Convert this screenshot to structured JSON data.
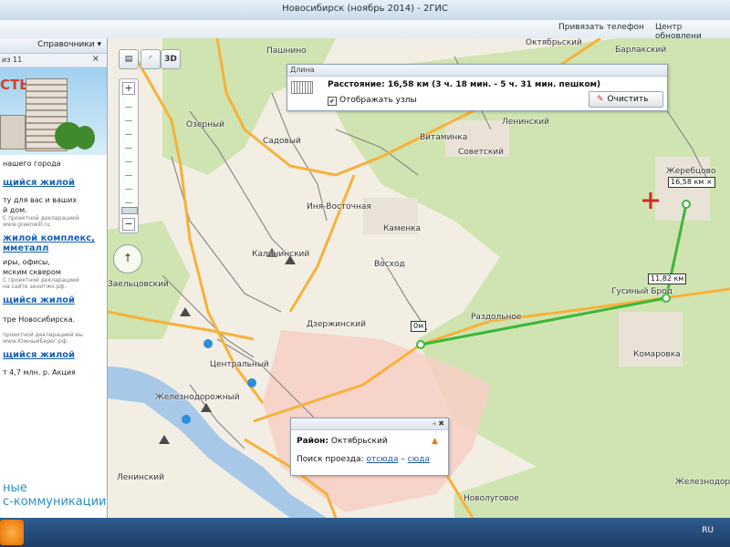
{
  "window": {
    "title": "Новосибирск (ноябрь 2014) - 2ГИС"
  },
  "toolbar": {
    "bind_phone": "Привязать телефон",
    "update_center": "Центр обновлени"
  },
  "sidebar": {
    "header": "Справочники ▾",
    "counter": "из 11",
    "close": "×",
    "ad_bigword": "СТЬ",
    "ad_caption": "нашего города",
    "blocks": [
      {
        "link": "щийся жилой",
        "text": "ту для вас и ваших\nй дом.",
        "note": "С проектной декларацией\nwww.greenwill.ru."
      },
      {
        "link": "жилой комплекс,\nмметалл",
        "text": "иры, офисы,\nмским сквером",
        "note": "С проектной декларацией\nна сайте зенитжк.рф."
      },
      {
        "link": "щийся жилой",
        "text": "тре Новосибирска.",
        "note": "проектной декларацией вы\nwww.ЮжныйБерег.рф."
      },
      {
        "link": "щийся жилой",
        "text": "т 4,7 млн. р. Акция\n",
        "note": ""
      }
    ],
    "bottom_line1": "ные",
    "bottom_line2": "с-коммуникации"
  },
  "map": {
    "controls": {
      "layers_icon": "layers-icon",
      "view3d": "3D",
      "zoom_in": "+",
      "zoom_out": "−",
      "compass": "↑"
    },
    "labels": [
      "Пашнино",
      "Октябрьский",
      "Барлакский",
      "Озерный",
      "Садовый",
      "Ленинский",
      "Витаминка",
      "Советский",
      "Жеребцово",
      "Иня-Восточная",
      "Каменка",
      "Калининский",
      "Восход",
      "Заельцовский",
      "Гусиный Брод",
      "Раздольное",
      "Дзержинский",
      "Комаровка",
      "Центральный",
      "Железнодорожный",
      "Ленинский",
      "Новолуговое",
      "Железнодор"
    ],
    "route_markers": [
      {
        "label": "0м"
      },
      {
        "label": "11,82 км"
      },
      {
        "label": "16,58 км ×"
      }
    ]
  },
  "distance_panel": {
    "title": "Длина",
    "distance_text": "Расстояние: 16,58 км (3 ч. 18 мин. - 5 ч. 31 мин. пешком)",
    "show_nodes": "Отображать узлы",
    "checked_mark": "✔",
    "clear_button": "Очистить"
  },
  "info_panel": {
    "district_label": "Район:",
    "district_value": "Октябрьский",
    "search_label": "Поиск проезда:",
    "from_link": "отсюда",
    "dash": "–",
    "to_link": "сюда"
  },
  "taskbar": {
    "lang": "RU"
  },
  "colors": {
    "route": "#3bb83a",
    "forest": "#cfe4b0",
    "road": "#f7b13a",
    "water": "#a8c8e8",
    "district": "#f7cfc6"
  }
}
